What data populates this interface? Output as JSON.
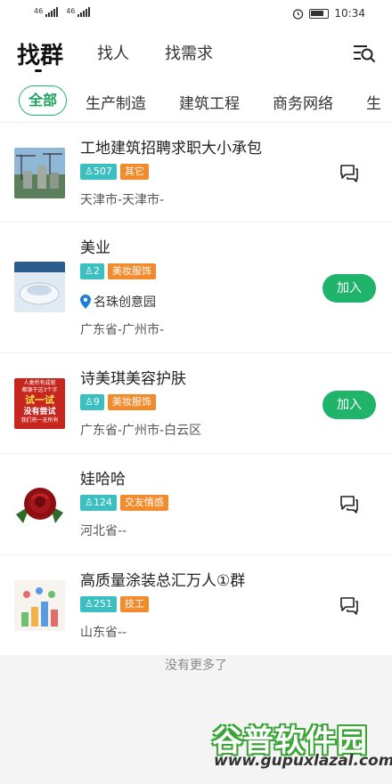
{
  "status": {
    "signal_left": "46",
    "signal_right": "46",
    "time": "10:34"
  },
  "top_nav": {
    "tabs": [
      "找群",
      "找人",
      "找需求"
    ],
    "active_index": 0
  },
  "categories": {
    "items": [
      "全部",
      "生产制造",
      "建筑工程",
      "商务网络",
      "生"
    ],
    "active_index": 0
  },
  "groups": [
    {
      "title": "工地建筑招聘求职大小承包",
      "members": "507",
      "category": "其它",
      "location": "",
      "region": "天津市-天津市-",
      "action": "chat"
    },
    {
      "title": "美业",
      "members": "2",
      "category": "美妆服饰",
      "location": "名珠创意园",
      "region": "广东省-广州市-",
      "action": "join"
    },
    {
      "title": "诗美琪美容护肤",
      "members": "9",
      "category": "美妆服饰",
      "location": "",
      "region": "广东省-广州市-白云区",
      "action": "join"
    },
    {
      "title": "娃哈哈",
      "members": "124",
      "category": "交友情感",
      "location": "",
      "region": "河北省--",
      "action": "chat"
    },
    {
      "title": "高质量涂装总汇万人①群",
      "members": "251",
      "category": "技工",
      "location": "",
      "region": "山东省--",
      "action": "chat"
    }
  ],
  "join_label": "加入",
  "thumb3_text": [
    "人类所有成就",
    "都源于这3个字",
    "试一试",
    "没有尝试",
    "我们将一无所有"
  ],
  "no_more_text": "没有更多了",
  "watermark": {
    "main": "谷普软件园",
    "url": "www.gupuxlazal.com"
  },
  "colors": {
    "accent": "#1fb46a",
    "member_tag": "#3cbfc1",
    "category_tag": "#f38a2c"
  }
}
